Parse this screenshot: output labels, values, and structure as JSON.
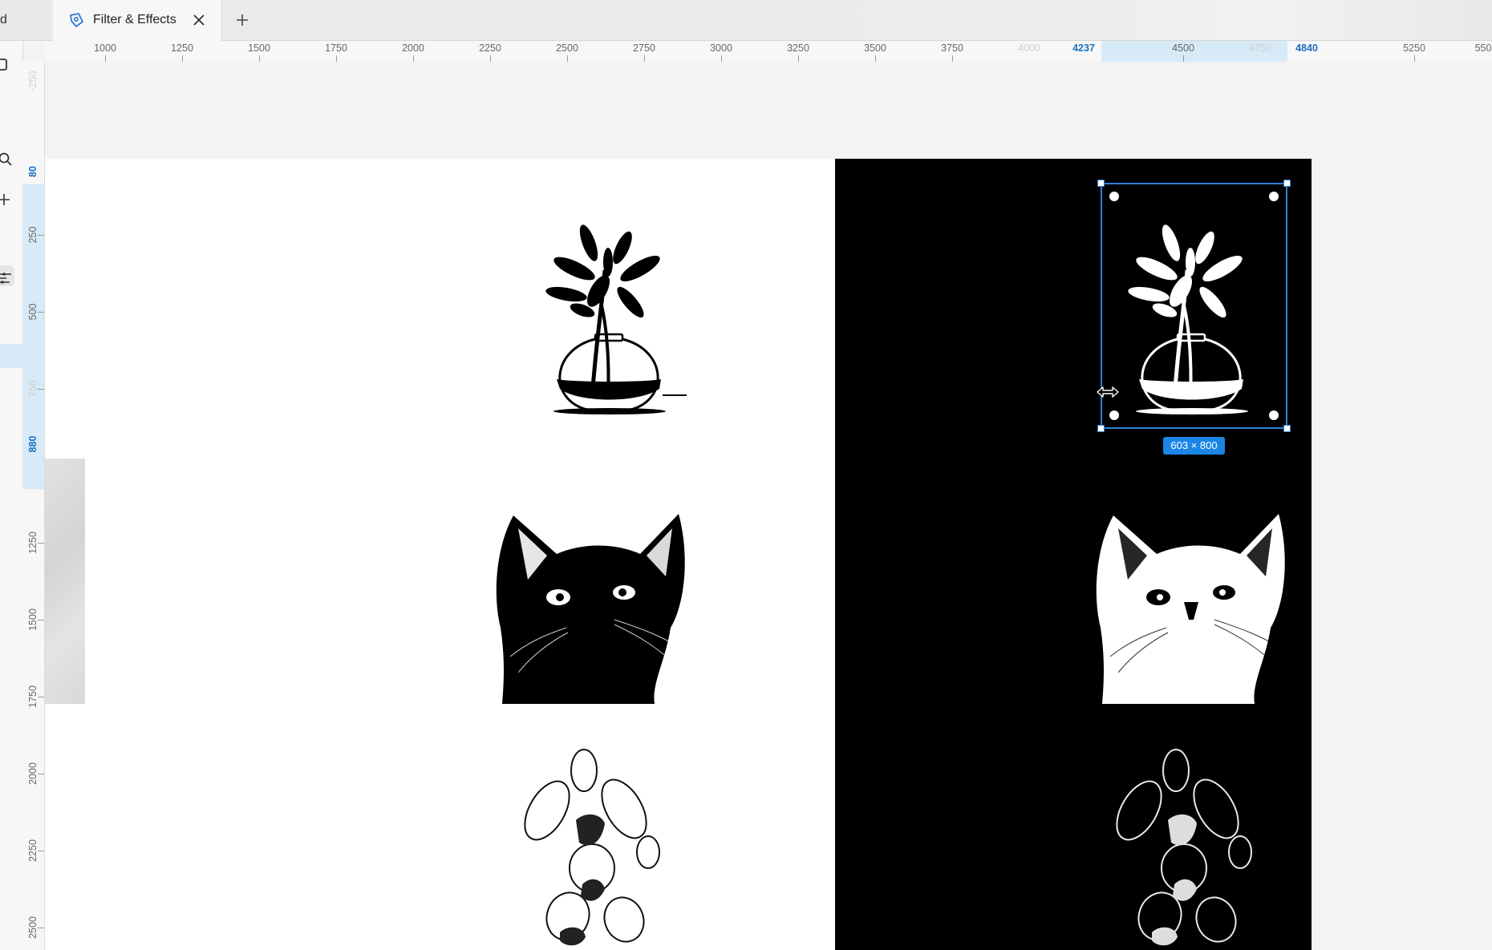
{
  "tabs": {
    "partial_label": "d",
    "active_label": "Filter & Effects"
  },
  "ruler_top": {
    "labels": [
      "1000",
      "1250",
      "1500",
      "1750",
      "2000",
      "2250",
      "2500",
      "2750",
      "3000",
      "3250",
      "3500",
      "3750",
      "4000",
      "4237",
      "4500",
      "4750",
      "4840",
      "5250",
      "550"
    ],
    "selection_start": "4237",
    "selection_end": "4840"
  },
  "ruler_left": {
    "labels": [
      "-250",
      "80",
      "250",
      "500",
      "750",
      "880",
      "1250",
      "1500",
      "1750",
      "2000",
      "2250",
      "2500"
    ],
    "selection_start": "80",
    "selection_end": "880"
  },
  "selection": {
    "size_label": "603 × 800"
  },
  "canvas": {
    "artworks": [
      "plant-in-vase-black",
      "plant-in-vase-white",
      "cat-black",
      "cat-white",
      "orchid-light",
      "orchid-dark"
    ]
  },
  "colors": {
    "accent": "#1b86e6",
    "selection_outline": "#2f7fd6",
    "ruler_highlight": "#d7eaf8",
    "canvas_bg": "#f3f3f3"
  }
}
